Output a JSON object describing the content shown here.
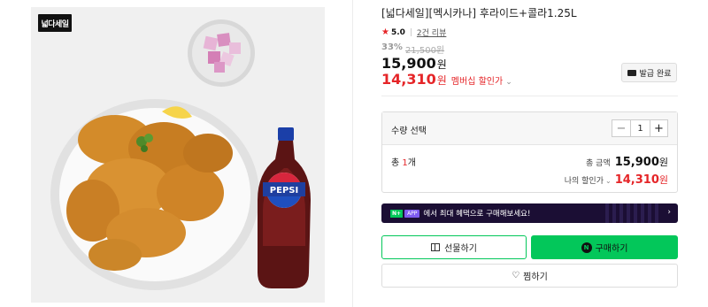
{
  "product": {
    "image_badge": "넓다세일",
    "title": "[넓다세일][멕시카나] 후라이드+콜라1.25L",
    "rating": "5.0",
    "reviews": "2건 리뷰",
    "discount_rate": "33%",
    "original_price": "21,500원",
    "price": "15,900",
    "won": "원",
    "member_price": "14,310",
    "member_label": "멤버십 할인가",
    "coupon_button": "발급 완료",
    "bottle_label": "PEPSI"
  },
  "order": {
    "qty_label": "수량 선택",
    "quantity": "1",
    "total_count_prefix": "총 ",
    "total_count_num": "1",
    "total_count_suffix": "개",
    "total_label": "총 금액",
    "total_price": "15,900",
    "my_discount_label": "나의 할인가",
    "my_discount_price": "14,310"
  },
  "promo": {
    "n_tag": "N+",
    "app_tag": "APP",
    "text": "에서 최대 혜택으로 구매해보세요!"
  },
  "buttons": {
    "gift": "선물하기",
    "buy": "구매하기",
    "wish": "찜하기"
  },
  "icons": {
    "star": "star-icon",
    "coupon": "coupon-icon",
    "minus": "minus-icon",
    "plus": "plus-icon",
    "gift": "gift-icon",
    "naver": "naver-n-icon",
    "heart": "heart-icon",
    "chevron": "chevron-down-icon"
  },
  "colors": {
    "accent_green": "#03c75a",
    "sale_red": "#e52528",
    "promo_bg": "#1b0e34"
  }
}
